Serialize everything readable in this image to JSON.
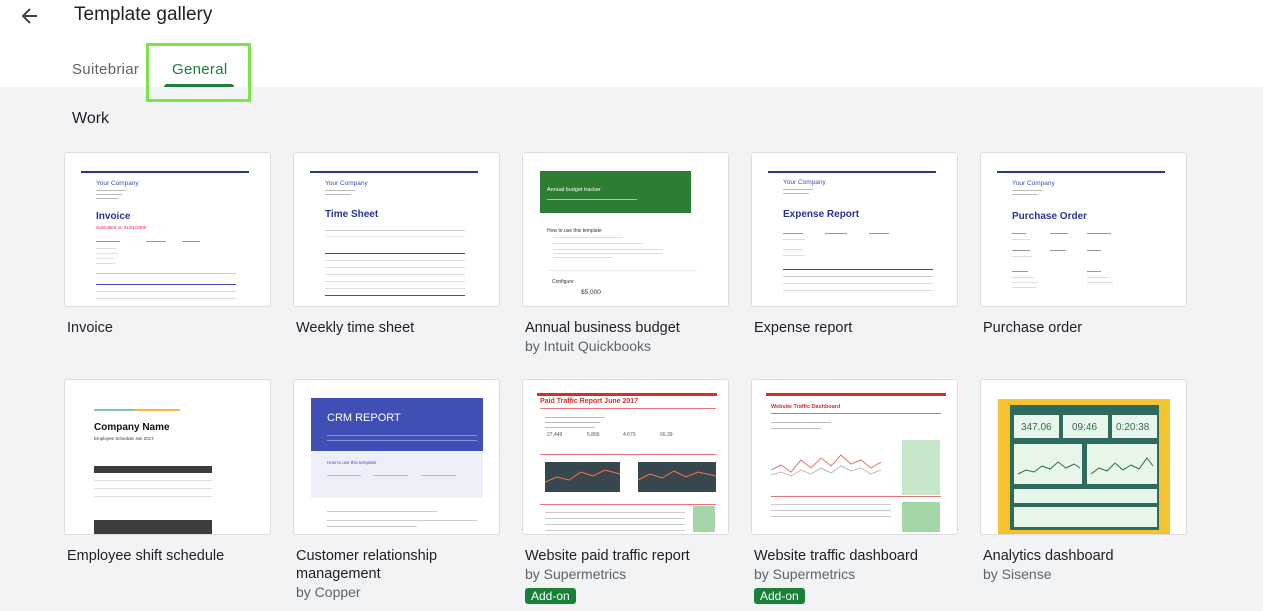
{
  "header": {
    "title": "Template gallery",
    "tabs": [
      {
        "label": "Suitebriar",
        "active": false
      },
      {
        "label": "General",
        "active": true
      }
    ]
  },
  "section": {
    "title": "Work"
  },
  "colors": {
    "accent": "#188038",
    "highlight": "#7ae44b",
    "navy": "#283593"
  },
  "templates": [
    {
      "title": "Invoice",
      "subtitle": "",
      "addon": "",
      "thumb": {
        "company": "Your Company",
        "heading": "Invoice",
        "note": "Submitted on 01/01/2000"
      }
    },
    {
      "title": "Weekly time sheet",
      "subtitle": "",
      "addon": "",
      "thumb": {
        "company": "Your Company",
        "heading": "Time Sheet"
      }
    },
    {
      "title": "Annual business budget",
      "subtitle": "by Intuit Quickbooks",
      "addon": "",
      "thumb": {
        "heading": "Annual budget tracker",
        "section": "How to use this template",
        "configure": "Configure",
        "amount": "$5,000"
      }
    },
    {
      "title": "Expense report",
      "subtitle": "",
      "addon": "",
      "thumb": {
        "company": "Your Company",
        "heading": "Expense Report"
      }
    },
    {
      "title": "Purchase order",
      "subtitle": "",
      "addon": "",
      "thumb": {
        "company": "Your Company",
        "heading": "Purchase Order"
      }
    },
    {
      "title": "Employee shift schedule",
      "subtitle": "",
      "addon": "",
      "thumb": {
        "heading": "Company Name",
        "note": "Employee Schedule Jan 2017"
      }
    },
    {
      "title": "Customer relationship management",
      "subtitle": "by Copper",
      "addon": "",
      "thumb": {
        "heading": "CRM REPORT",
        "section": "How to use this template"
      }
    },
    {
      "title": "Website paid traffic report",
      "subtitle": "by Supermetrics",
      "addon": "Add-on",
      "thumb": {
        "heading": "Paid Traffic Report June 2017"
      }
    },
    {
      "title": "Website traffic dashboard",
      "subtitle": "by Supermetrics",
      "addon": "Add-on",
      "thumb": {
        "heading": "Website Traffic Dashboard"
      }
    },
    {
      "title": "Analytics dashboard",
      "subtitle": "by Sisense",
      "addon": "",
      "thumb": {
        "v1": "347.06",
        "v2": "09:46",
        "v3": "0:20:38"
      }
    }
  ]
}
